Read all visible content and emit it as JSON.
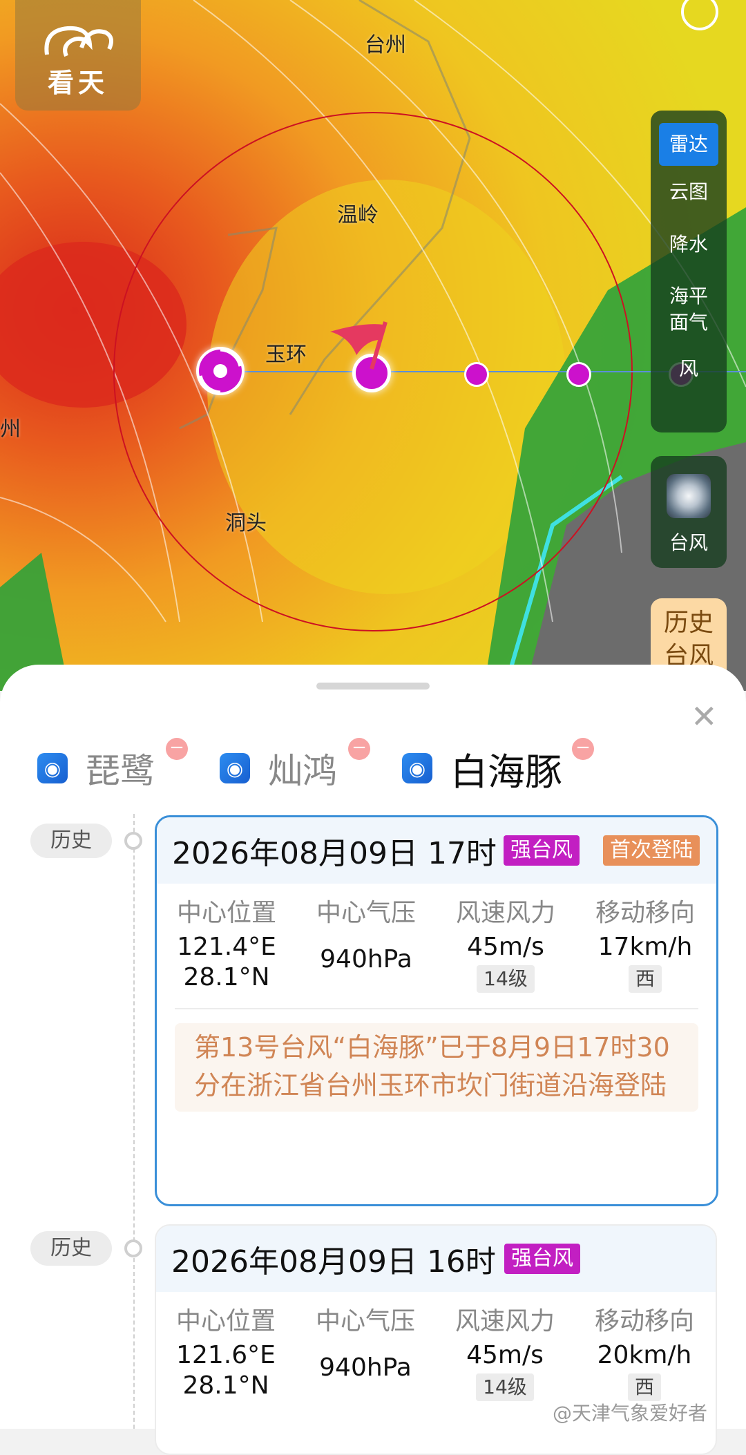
{
  "app": {
    "logo_text": "看天"
  },
  "map": {
    "cities": [
      "台州",
      "温岭",
      "玉环",
      "洞头",
      "州"
    ],
    "layers": [
      {
        "label": "雷达",
        "active": true
      },
      {
        "label": "云图",
        "active": false
      },
      {
        "label": "降水",
        "active": false
      },
      {
        "label": "海平面气",
        "active": false
      },
      {
        "label": "风",
        "active": false
      }
    ],
    "typhoon_button": "台风",
    "history_button": "历史台风"
  },
  "tabs": [
    {
      "label": "琵鹭",
      "active": false
    },
    {
      "label": "灿鸿",
      "active": false
    },
    {
      "label": "白海豚",
      "active": true
    }
  ],
  "timeline": [
    {
      "tag": "历史",
      "time": "2026年08月09日 17时",
      "badges": [
        "强台风",
        "首次登陆"
      ],
      "columns": {
        "position": {
          "title": "中心位置",
          "lon": "121.4°E",
          "lat": "28.1°N"
        },
        "pressure": {
          "title": "中心气压",
          "value": "940hPa"
        },
        "wind": {
          "title": "风速风力",
          "value": "45m/s",
          "level": "14级"
        },
        "move": {
          "title": "移动移向",
          "value": "17km/h",
          "dir": "西"
        }
      },
      "note": "第13号台风“白海豚”已于8月9日17时30分在浙江省台州玉环市坎门街道沿海登陆"
    },
    {
      "tag": "历史",
      "time": "2026年08月09日 16时",
      "badges": [
        "强台风"
      ],
      "columns": {
        "position": {
          "title": "中心位置",
          "lon": "121.6°E",
          "lat": "28.1°N"
        },
        "pressure": {
          "title": "中心气压",
          "value": "940hPa"
        },
        "wind": {
          "title": "风速风力",
          "value": "45m/s",
          "level": "14级"
        },
        "move": {
          "title": "移动移向",
          "value": "20km/h",
          "dir": "西"
        }
      }
    }
  ],
  "watermark": "@天津气象爱好者",
  "colors": {
    "strong_typhoon": "#c21fc2",
    "landfall": "#e8905a",
    "accent": "#1a7fe6",
    "track": "#cc11cc"
  }
}
